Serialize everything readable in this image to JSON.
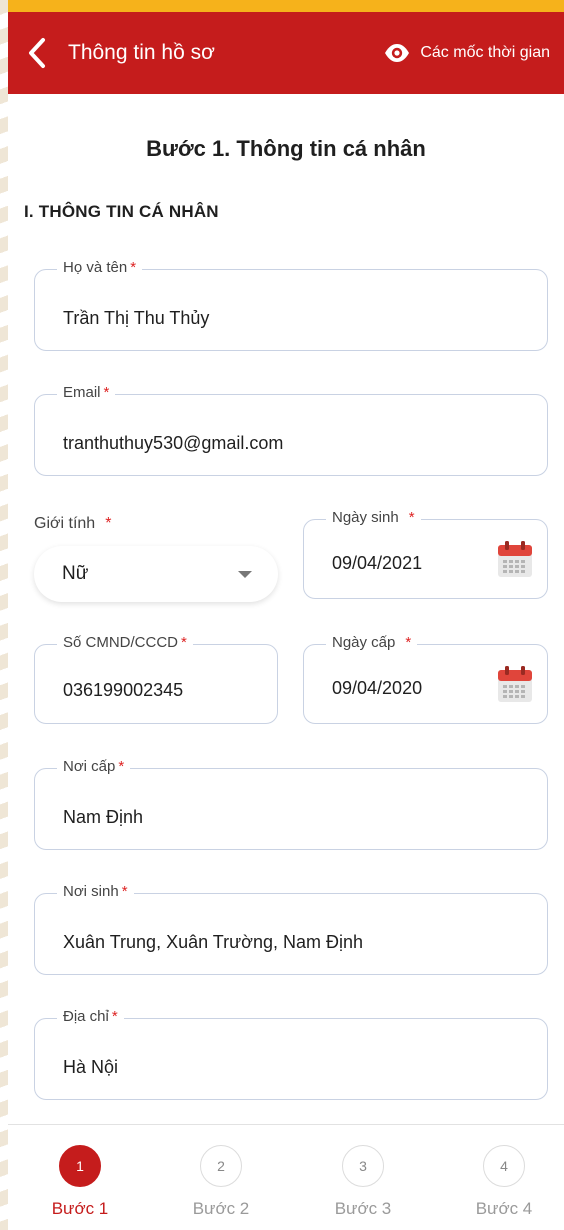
{
  "header": {
    "title": "Thông tin hồ sơ",
    "timeline_label": "Các mốc thời gian",
    "back_icon": "chevron-left-icon",
    "timeline_icon": "eye-icon",
    "bg_color": "#c51c1c"
  },
  "step_title": "Bước 1. Thông tin cá nhân",
  "section_title": "I. THÔNG TIN CÁ NHÂN",
  "required_mark": "*",
  "form": {
    "full_name": {
      "label": "Họ và tên",
      "value": "Trần Thị Thu Thủy"
    },
    "email": {
      "label": "Email",
      "value": "tranthuthuy530@gmail.com"
    },
    "gender": {
      "label": "Giới tính",
      "value": "Nữ"
    },
    "birth_date": {
      "label": "Ngày sinh",
      "value": "09/04/2021"
    },
    "id_number": {
      "label": "Số CMND/CCCD",
      "value": "036199002345"
    },
    "issue_date": {
      "label": "Ngày cấp",
      "value": "09/04/2020"
    },
    "issue_place": {
      "label": "Nơi cấp",
      "value": "Nam Định"
    },
    "birth_place": {
      "label": "Nơi sinh",
      "value": "Xuân Trung, Xuân Trường, Nam Định"
    },
    "address": {
      "label": "Địa chỉ",
      "value": "Hà Nội"
    }
  },
  "steps": [
    {
      "number": "1",
      "label": "Bước 1",
      "active": true
    },
    {
      "number": "2",
      "label": "Bước 2",
      "active": false
    },
    {
      "number": "3",
      "label": "Bước 3",
      "active": false
    },
    {
      "number": "4",
      "label": "Bước 4",
      "active": false
    }
  ],
  "colors": {
    "accent": "#c51c1c",
    "border": "#c9d2e3",
    "calendar_red": "#e0453b"
  }
}
